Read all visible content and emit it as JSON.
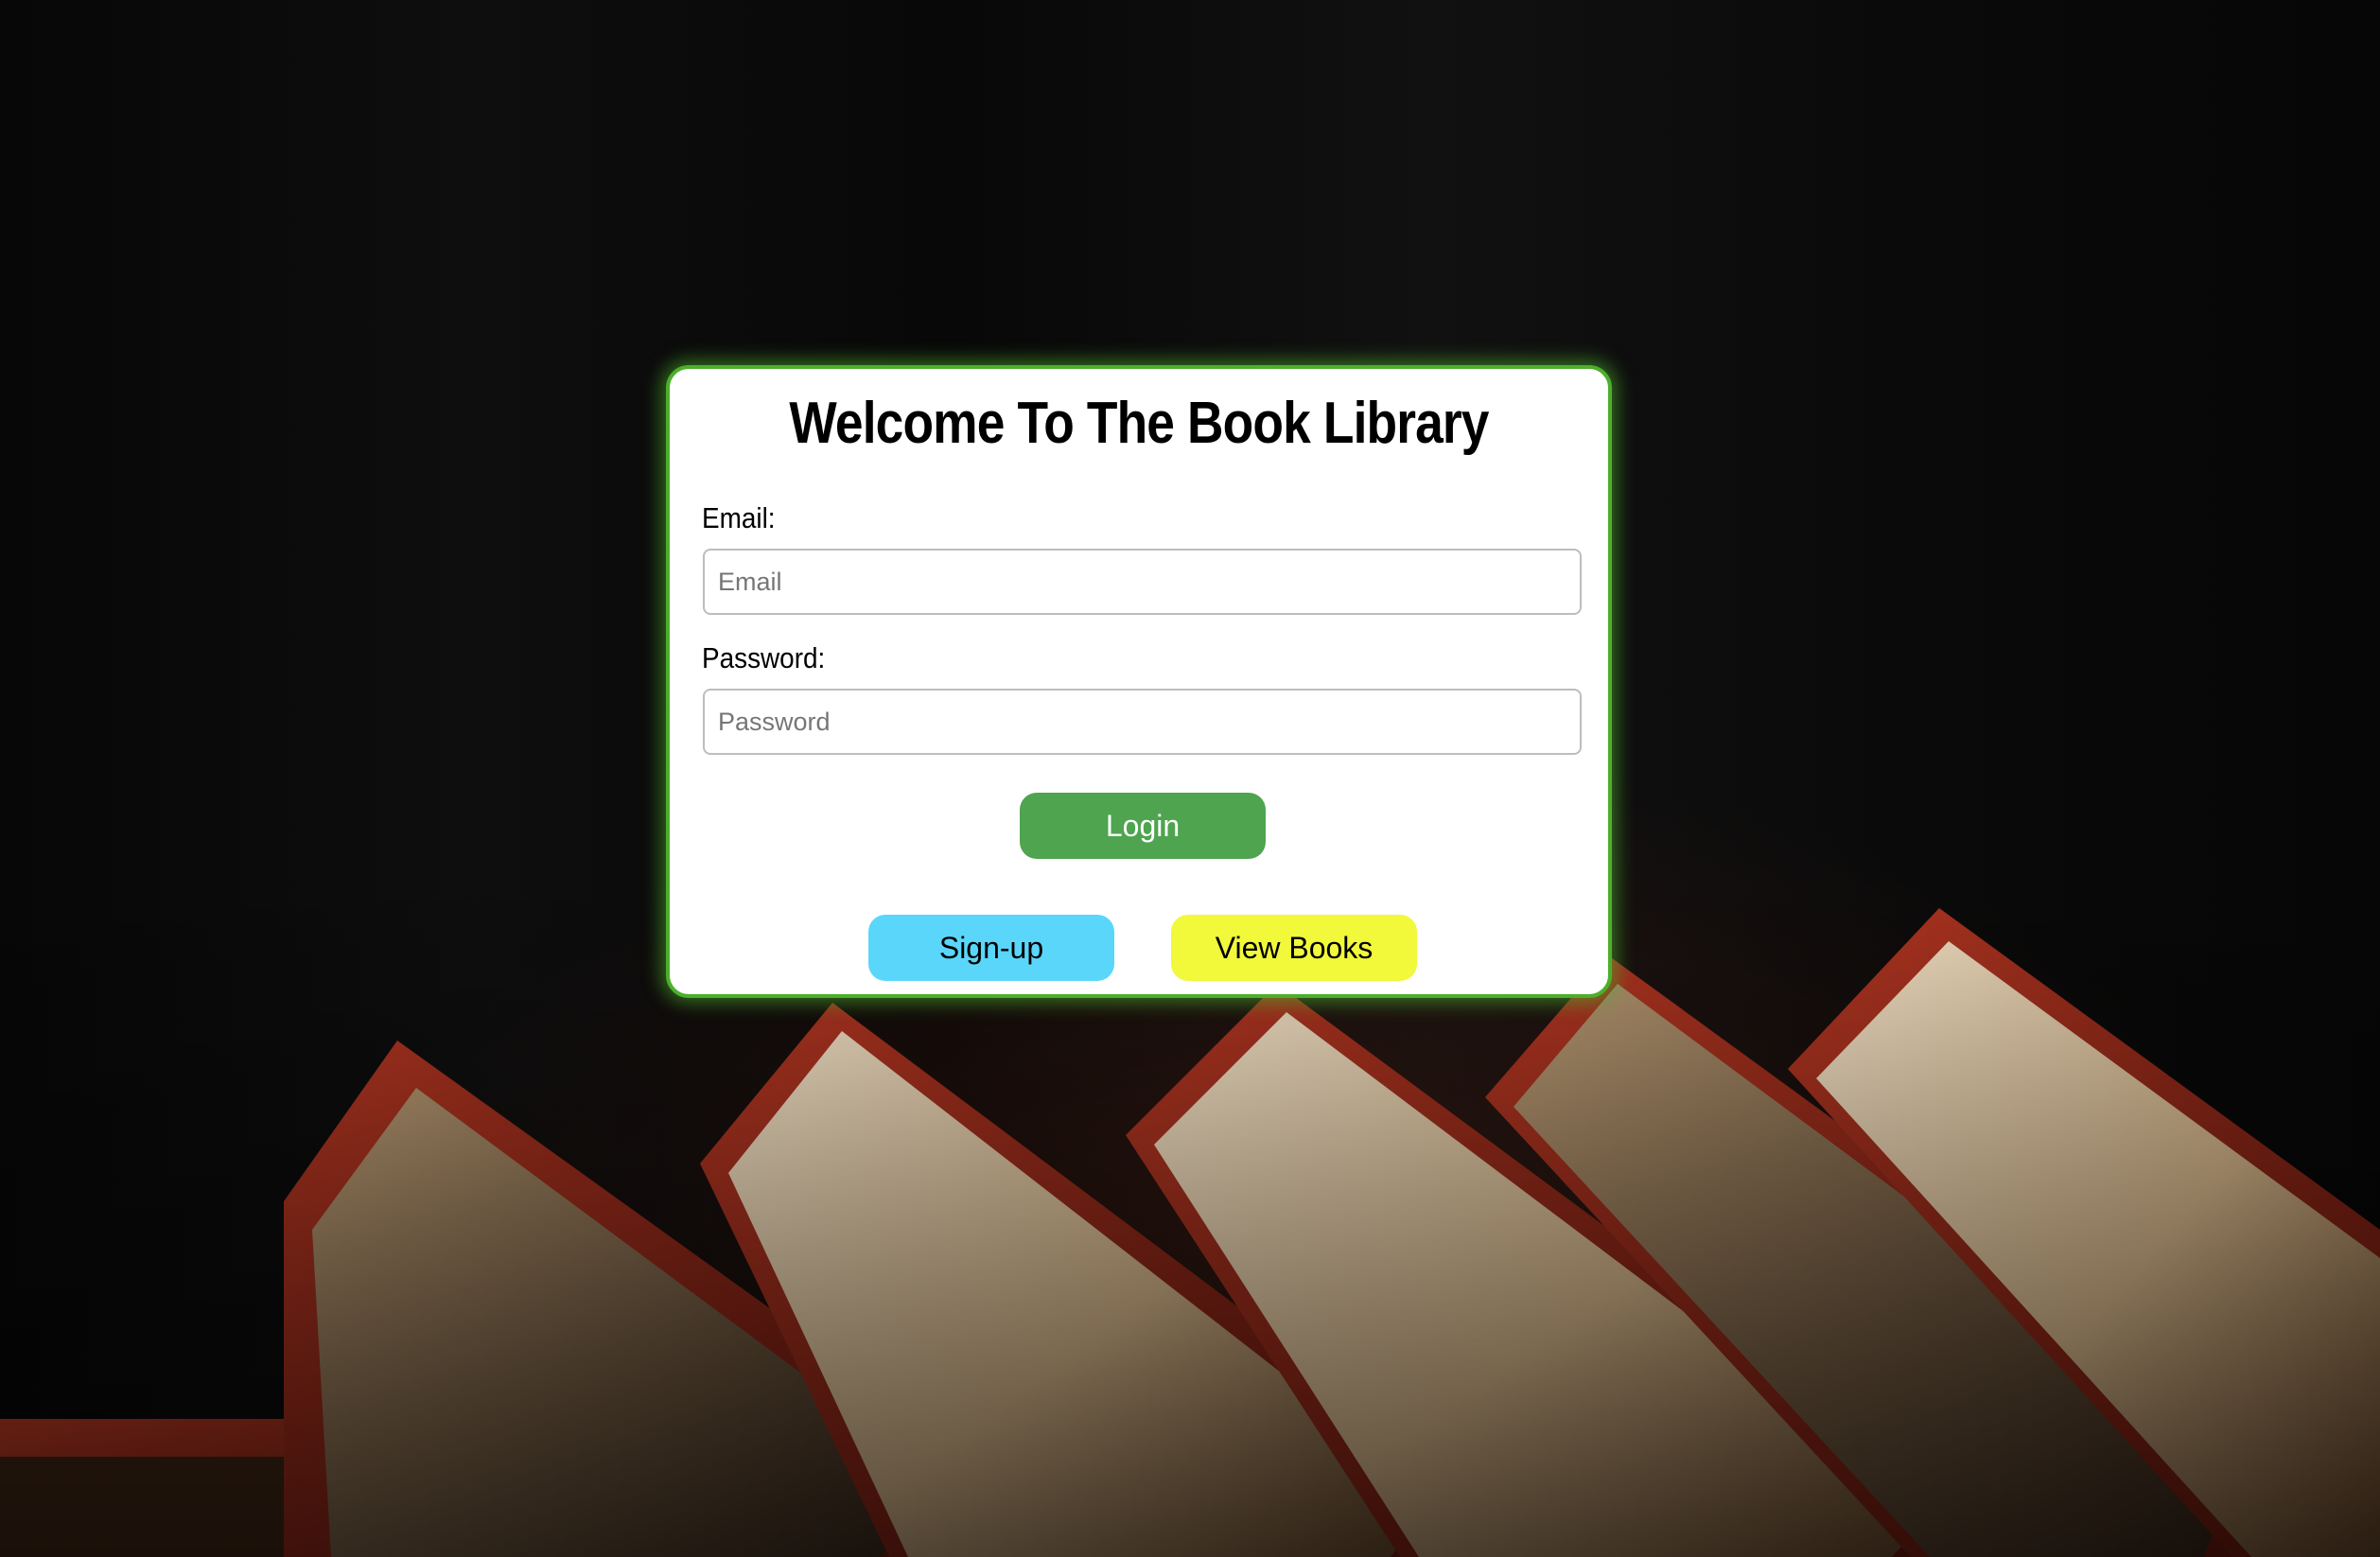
{
  "page": {
    "title": "Welcome To The Book Library"
  },
  "form": {
    "email_label": "Email:",
    "email_placeholder": "Email",
    "email_value": "",
    "password_label": "Password:",
    "password_placeholder": "Password",
    "password_value": "",
    "login_label": "Login"
  },
  "actions": {
    "signup_label": "Sign-up",
    "view_books_label": "View Books"
  },
  "colors": {
    "card_border": "#4caf2c",
    "login_button": "#4ea44f",
    "signup_button": "#5ad6fa",
    "view_books_button": "#f2f83a"
  }
}
